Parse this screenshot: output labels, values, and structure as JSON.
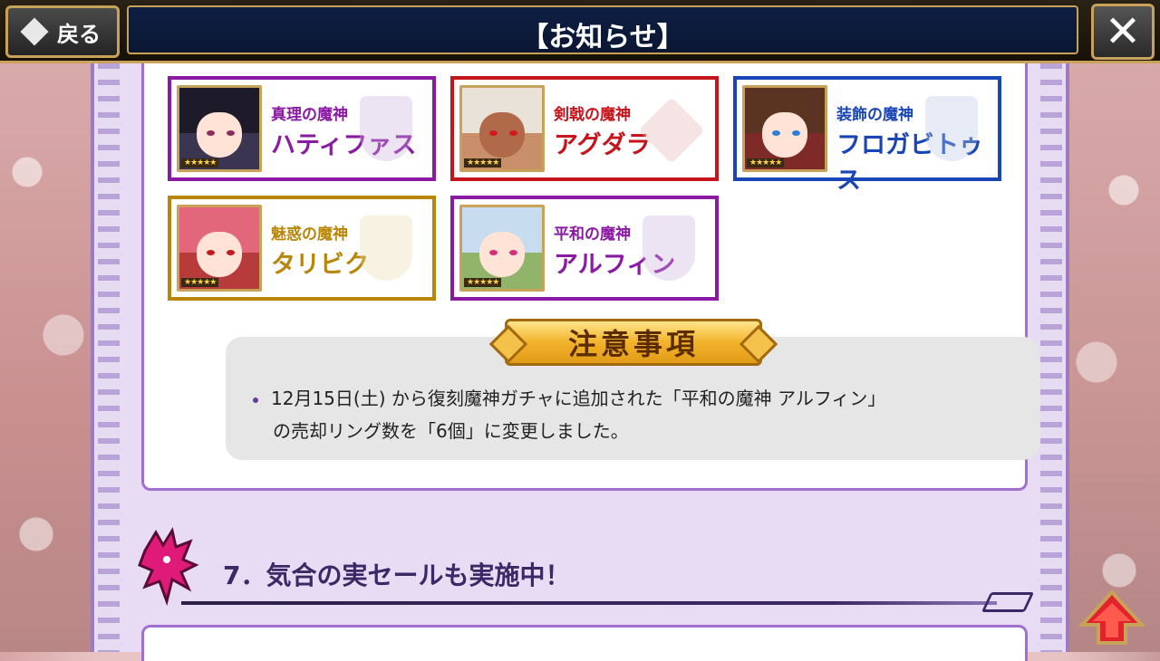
{
  "header": {
    "back_label": "戻る",
    "title": "【お知らせ】"
  },
  "characters": [
    {
      "title": "真理の魔神",
      "name": "ハティファス",
      "color": "#8b1aa3"
    },
    {
      "title": "剣戟の魔神",
      "name": "アグダラ",
      "color": "#c5141b"
    },
    {
      "title": "装飾の魔神",
      "name": "フロガビトゥス",
      "color": "#1a46b5"
    },
    {
      "title": "魅惑の魔神",
      "name": "タリビク",
      "color": "#b8860b"
    },
    {
      "title": "平和の魔神",
      "name": "アルフィン",
      "color": "#8b1aa3"
    }
  ],
  "notice": {
    "banner": "注意事項",
    "line1": "12月15日(土) から復刻魔神ガチャに追加された「平和の魔神 アルフィン」",
    "line2": "の売却リング数を「6個」に変更しました。"
  },
  "section": {
    "title": "7．気合の実セールも実施中！"
  }
}
